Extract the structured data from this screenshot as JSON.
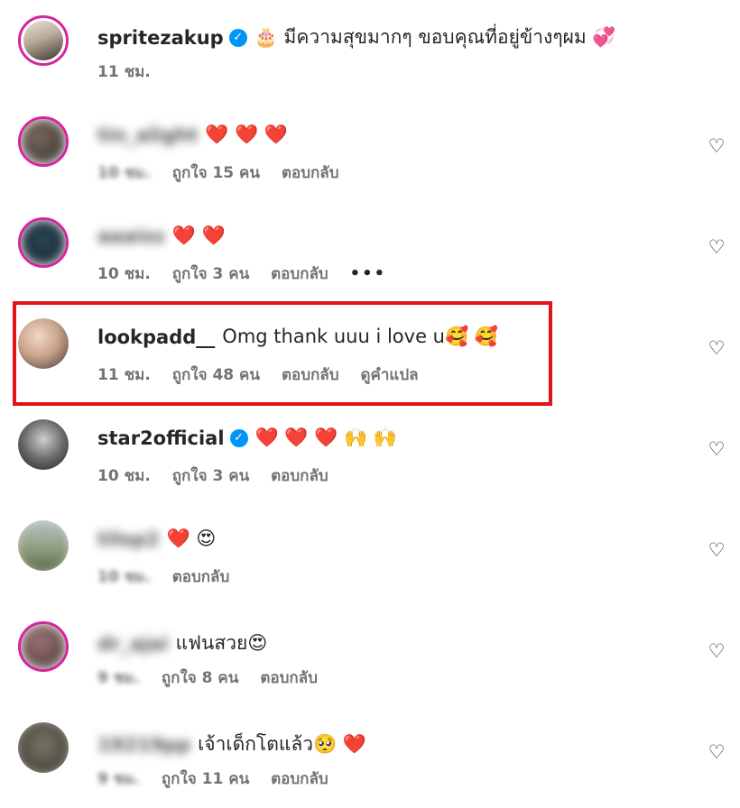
{
  "comments": [
    {
      "username": "spritezakup",
      "verified": true,
      "text": "🎂 มีความสุขมากๆ ขอบคุณที่อยู่ข้างๆผม 💞",
      "time": "11 ชม.",
      "likes": "",
      "reply": "",
      "extra": ""
    },
    {
      "username": "tin_alight",
      "text": "❤️ ❤️ ❤️",
      "time": "10 ชม.",
      "likes": "ถูกใจ 15 คน",
      "reply": "ตอบกลับ",
      "extra": ""
    },
    {
      "username": "aaaiss",
      "text": "❤️ ❤️",
      "time": "10 ชม.",
      "likes": "ถูกใจ 3 คน",
      "reply": "ตอบกลับ",
      "extra": "•••"
    },
    {
      "username": "lookpadd__",
      "text": "Omg thank uuu i love u🥰 🥰",
      "time": "11 ชม.",
      "likes": "ถูกใจ 48 คน",
      "reply": "ตอบกลับ",
      "extra": "ดูคำแปล"
    },
    {
      "username": "star2official",
      "verified": true,
      "text": "❤️ ❤️ ❤️ 🙌 🙌",
      "time": "10 ชม.",
      "likes": "ถูกใจ 3 คน",
      "reply": "ตอบกลับ",
      "extra": ""
    },
    {
      "username": "tilop2",
      "text": "❤️ 😍",
      "time": "10 ชม.",
      "likes": "",
      "reply": "ตอบกลับ",
      "extra": ""
    },
    {
      "username": "dr_ajai",
      "text": "แฟนสวย😍",
      "time": "9 ชม.",
      "likes": "ถูกใจ 8 คน",
      "reply": "ตอบกลับ",
      "extra": ""
    },
    {
      "username": "19219pp",
      "text": "เจ้าเด็กโตแล้ว🥺 ❤️",
      "time": "9 ชม.",
      "likes": "ถูกใจ 11 คน",
      "reply": "ตอบกลับ",
      "extra": ""
    }
  ],
  "icons": {
    "like": "heart-outline-icon",
    "verified": "verified-badge-icon"
  },
  "colors": {
    "highlight": "#e0141a",
    "verified": "#0095f6",
    "meta": "#737373"
  }
}
